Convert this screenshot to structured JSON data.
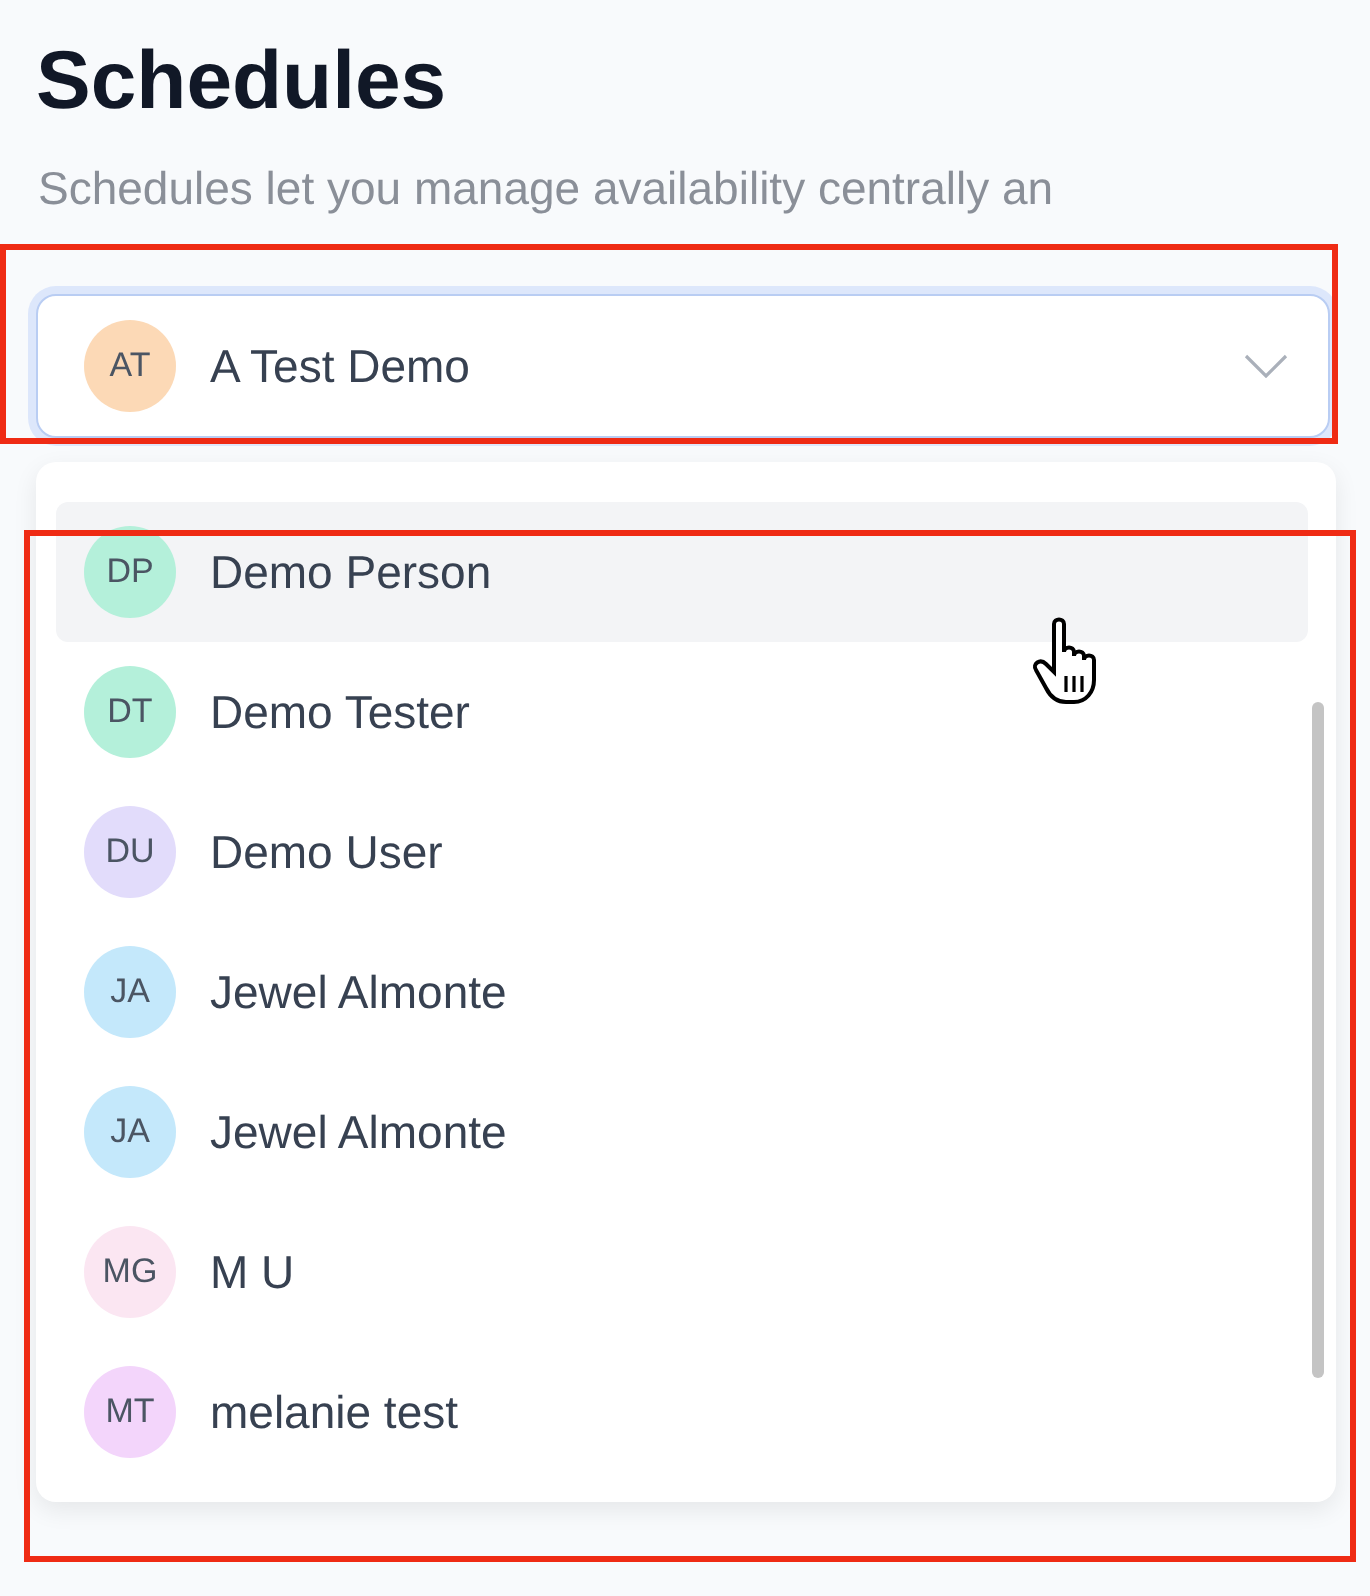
{
  "page": {
    "title": "Schedules",
    "description": "Schedules let you manage availability centrally an"
  },
  "select": {
    "initials": "AT",
    "color": "#fcd9b6",
    "value": "A Test Demo",
    "open": true
  },
  "options": [
    {
      "initials": "DP",
      "name": "Demo Person",
      "color": "#b4f0da",
      "selected": true
    },
    {
      "initials": "DT",
      "name": "Demo Tester",
      "color": "#b4f0da",
      "selected": false
    },
    {
      "initials": "DU",
      "name": "Demo User",
      "color": "#e2dcfb",
      "selected": false
    },
    {
      "initials": "JA",
      "name": "Jewel Almonte",
      "color": "#c4e8fb",
      "selected": false
    },
    {
      "initials": "JA",
      "name": "Jewel Almonte",
      "color": "#c4e8fb",
      "selected": false
    },
    {
      "initials": "MG",
      "name": "M U",
      "color": "#fbe6f2",
      "selected": false
    },
    {
      "initials": "MT",
      "name": "melanie test",
      "color": "#f3d5fb",
      "selected": false
    }
  ]
}
